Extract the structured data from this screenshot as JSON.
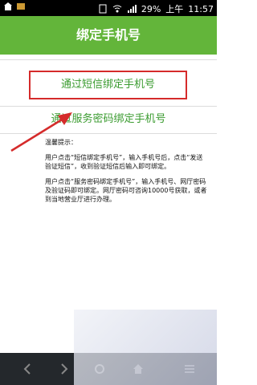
{
  "status": {
    "battery": "29%",
    "am_pm": "上午",
    "time": "11:57"
  },
  "header": {
    "title": "绑定手机号"
  },
  "options": {
    "sms_bind": "通过短信绑定手机号",
    "service_pwd_bind": "通过服务密码绑定手机号"
  },
  "tips": {
    "title": "温馨提示：",
    "p1": "用户点击“短信绑定手机号”，输入手机号后，点击“发送验证短信”，收到验证短信后输入即可绑定。",
    "p2": "用户点击“服务密码绑定手机号”，输入手机号、网厅密码及验证码即可绑定。网厅密码可咨询10000号获取，或者到当地营业厅进行办理。"
  }
}
